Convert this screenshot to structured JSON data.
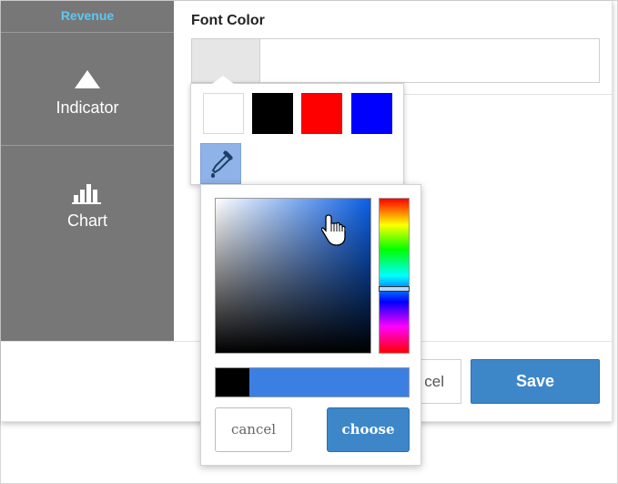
{
  "sidebar": {
    "items": [
      {
        "label": "Revenue",
        "icon": "none"
      },
      {
        "label": "Indicator",
        "icon": "triangle-icon"
      },
      {
        "label": "Chart",
        "icon": "bar-chart-icon"
      }
    ]
  },
  "form": {
    "font_color_label": "Font Color",
    "color_value": ""
  },
  "footer": {
    "cancel_label_partial": "cel",
    "save_label": "Save"
  },
  "swatches": {
    "colors": [
      "#ffffff",
      "#000000",
      "#ff0000",
      "#0000ff"
    ],
    "eyedropper_icon": "eyedropper-icon"
  },
  "picker": {
    "cancel_label": "cancel",
    "choose_label": "choose",
    "previous_color": "#000000",
    "new_color": "#3c7fe3"
  },
  "colors": {
    "sidebar_bg": "#777777",
    "accent": "#3d87c9",
    "revenue_label": "#5ec8f2"
  }
}
